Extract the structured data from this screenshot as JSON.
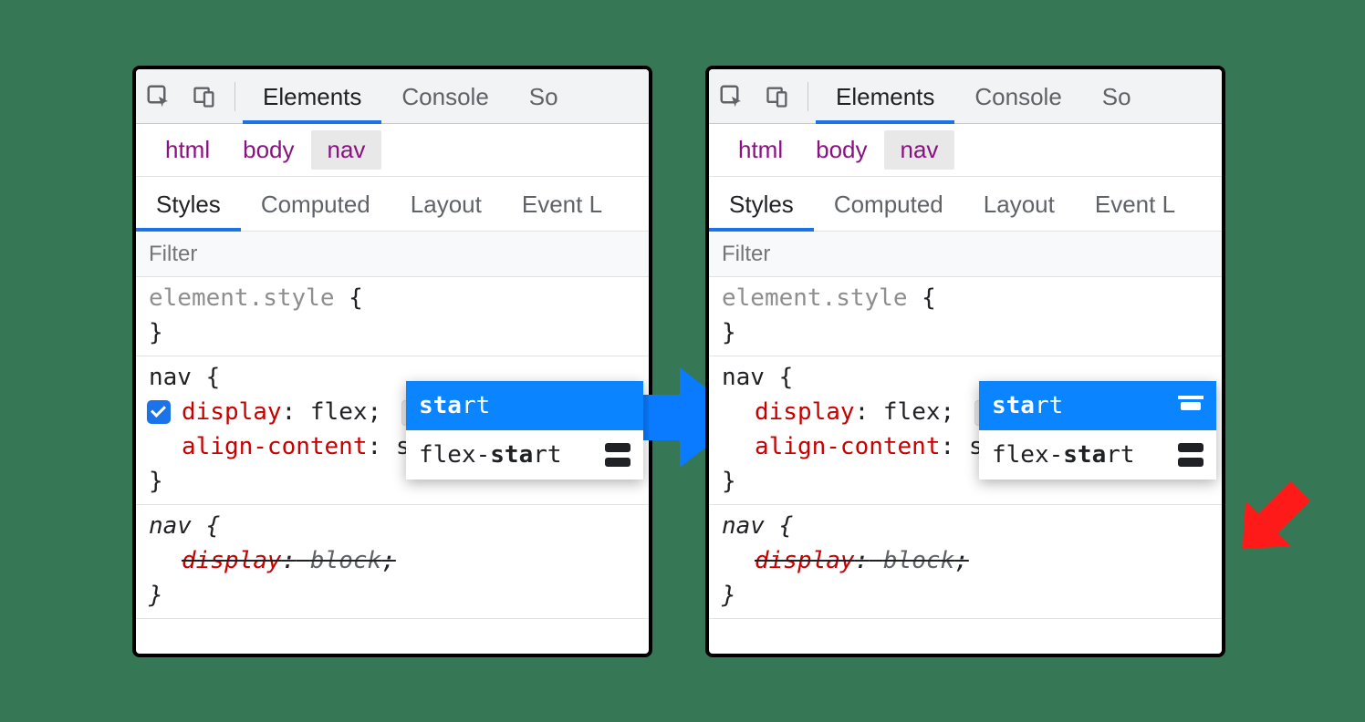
{
  "toolbar": {
    "tabs": [
      "Elements",
      "Console",
      "So"
    ],
    "active": 0
  },
  "breadcrumbs": [
    "html",
    "body",
    "nav"
  ],
  "subtabs": [
    "Styles",
    "Computed",
    "Layout",
    "Event L"
  ],
  "subtab_active": 0,
  "filter_placeholder": "Filter",
  "element_style_label": "element.style",
  "rule_nav": {
    "selector": "nav",
    "props": [
      {
        "name": "display",
        "value": "flex"
      },
      {
        "name": "align-content",
        "value": "start"
      }
    ]
  },
  "rule_nav_ua": {
    "selector": "nav",
    "prop": "display",
    "value": "block"
  },
  "autocomplete_left": {
    "typed_bold": "sta",
    "typed_rest": "rt",
    "items": [
      {
        "bold": "sta",
        "rest": "rt",
        "selected": true,
        "has_icon": false
      },
      {
        "pre": "flex-",
        "bold": "sta",
        "rest": "rt",
        "selected": false,
        "has_icon": true
      }
    ]
  },
  "autocomplete_right": {
    "typed_bold": "sta",
    "typed_rest": "rt",
    "items": [
      {
        "bold": "sta",
        "rest": "rt",
        "selected": true,
        "has_icon": true
      },
      {
        "pre": "flex-",
        "bold": "sta",
        "rest": "rt",
        "selected": false,
        "has_icon": true
      }
    ]
  },
  "punct": {
    "open": "{",
    "close": "}",
    "colon": ":",
    "semi": ";"
  }
}
